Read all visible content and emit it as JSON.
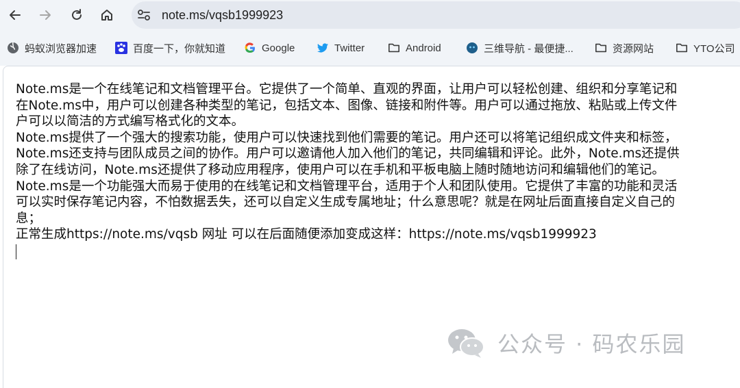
{
  "browser": {
    "url": "note.ms/vqsb1999923",
    "bookmarks": [
      {
        "label": "蚂蚁浏览器加速",
        "icon": "globe-icon"
      },
      {
        "label": "百度一下，你就知道",
        "icon": "baidu-paw-icon"
      },
      {
        "label": "Google",
        "icon": "google-g-icon"
      },
      {
        "label": "Twitter",
        "icon": "twitter-bird-icon"
      },
      {
        "label": "Android",
        "icon": "folder-icon"
      },
      {
        "label": "三维导航 - 最便捷...",
        "icon": "site-icon"
      },
      {
        "label": "资源网站",
        "icon": "folder-icon"
      },
      {
        "label": "YTO公司",
        "icon": "folder-icon"
      }
    ]
  },
  "note": {
    "lines": [
      "Note.ms是一个在线笔记和文档管理平台。它提供了一个简单、直观的界面，让用户可以轻松创建、组织和分享笔记和",
      "在Note.ms中，用户可以创建各种类型的笔记，包括文本、图像、链接和附件等。用户可以通过拖放、粘贴或上传文件",
      "户可以以简洁的方式编写格式化的文本。",
      "Note.ms提供了一个强大的搜索功能，使用户可以快速找到他们需要的笔记。用户还可以将笔记组织成文件夹和标签，",
      "Note.ms还支持与团队成员之间的协作。用户可以邀请他人加入他们的笔记，共同编辑和评论。此外，Note.ms还提供",
      "除了在线访问，Note.ms还提供了移动应用程序，使用户可以在手机和平板电脑上随时随地访问和编辑他们的笔记。",
      "Note.ms是一个功能强大而易于使用的在线笔记和文档管理平台，适用于个人和团队使用。它提供了丰富的功能和灵活",
      "可以实时保存笔记内容，不怕数据丢失，还可以自定义生成专属地址；什么意思呢？就是在网址后面直接自定义自己的",
      "息；",
      "正常生成https://note.ms/vqsb 网址  可以在后面随便添加变成这样：https://note.ms/vqsb1999923"
    ]
  },
  "watermark": {
    "text": "公众号 · 码农乐园",
    "icon": "wechat-icon"
  }
}
